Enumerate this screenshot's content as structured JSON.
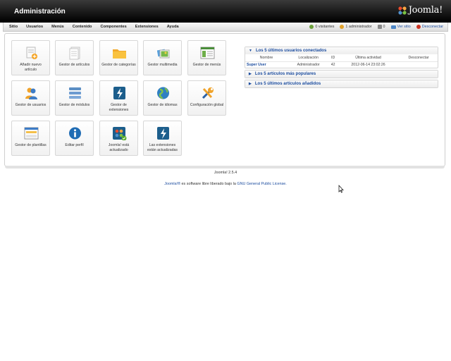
{
  "header": {
    "title": "Administración",
    "logo_text": "Joomla!"
  },
  "menu": [
    {
      "id": "sitio",
      "label": "Sitio"
    },
    {
      "id": "usuarios",
      "label": "Usuarios"
    },
    {
      "id": "menus",
      "label": "Menús"
    },
    {
      "id": "contenido",
      "label": "Contenido"
    },
    {
      "id": "componentes",
      "label": "Componentes"
    },
    {
      "id": "extensiones",
      "label": "Extensiones"
    },
    {
      "id": "ayuda",
      "label": "Ayuda"
    }
  ],
  "status": {
    "visitors": "0 visitantes",
    "admins": "1 administrador",
    "messages": "0",
    "view_site": "Ver sitio",
    "logout": "Desconectar"
  },
  "quickicons": [
    {
      "label": "Añadir nuevo artículo",
      "icon": "new-article-icon"
    },
    {
      "label": "Gestor de artículos",
      "icon": "article-manager-icon"
    },
    {
      "label": "Gestor de categorías",
      "icon": "folder-icon"
    },
    {
      "label": "Gestor multimedia",
      "icon": "media-icon"
    },
    {
      "label": "Gestor de menús",
      "icon": "menu-manager-icon"
    },
    {
      "label": "Gestor de usuarios",
      "icon": "users-icon"
    },
    {
      "label": "Gestor de módulos",
      "icon": "modules-icon"
    },
    {
      "label": "Gestor de extensiones",
      "icon": "extensions-icon"
    },
    {
      "label": "Gestor de idiomas",
      "icon": "globe-icon"
    },
    {
      "label": "Configuración global",
      "icon": "tools-icon"
    },
    {
      "label": "Gestor de plantillas",
      "icon": "templates-icon"
    },
    {
      "label": "Editar perfil",
      "icon": "info-icon"
    },
    {
      "label": "Joomla! está actualizado",
      "icon": "joomla-updated-icon"
    },
    {
      "label": "Las extensiones están actualizadas",
      "icon": "extensions-updated-icon"
    }
  ],
  "modules": {
    "logged": {
      "title": "Los 5 últimos usuarios conectados",
      "columns": [
        "Nombre",
        "Localización",
        "ID",
        "Última actividad",
        "Desconectar"
      ],
      "rows": [
        {
          "name": "Super User",
          "location": "Administrador",
          "id": "42",
          "last": "2012-06-14 23:02:26",
          "logout": ""
        }
      ]
    },
    "popular": {
      "title": "Los 5 artículos más populares"
    },
    "latest": {
      "title": "Los 5 últimos artículos añadidos"
    }
  },
  "footer": {
    "version": "Joomla! 2.5.4",
    "license_link1": "Joomla!®",
    "license_text": " es software libre liberado bajo la ",
    "license_link2": "GNU General Public License."
  },
  "colors": {
    "link": "#1a4b9e",
    "header_bg": "#111111"
  }
}
